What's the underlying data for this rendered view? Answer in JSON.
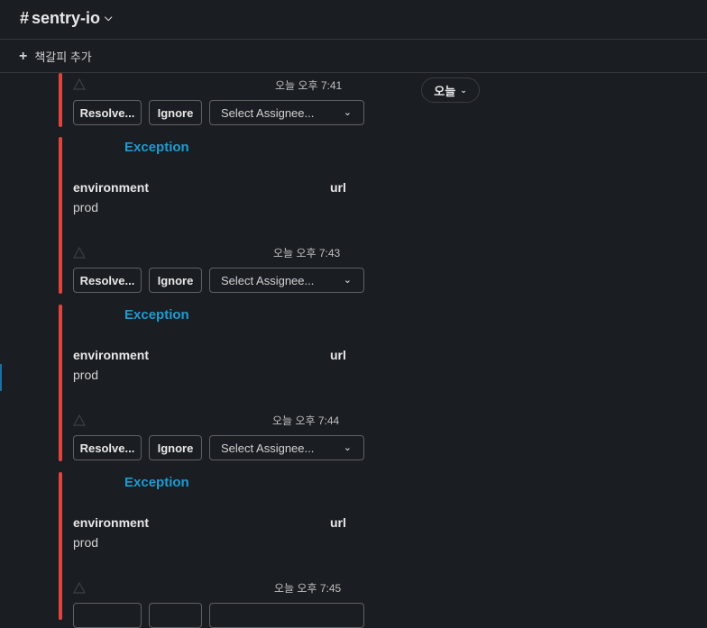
{
  "header": {
    "channel_name": "sentry-io"
  },
  "bookmarks": {
    "add_label": "책갈피 추가"
  },
  "date_pill": {
    "label": "오늘"
  },
  "messages": [
    {
      "exception": "",
      "timestamp": "오늘 오후 7:41",
      "actions": {
        "resolve": "Resolve...",
        "ignore": "Ignore",
        "assignee_placeholder": "Select Assignee..."
      }
    },
    {
      "exception": "Exception",
      "fields": [
        {
          "label": "environment",
          "value": "prod"
        },
        {
          "label": "url",
          "value": ""
        }
      ],
      "timestamp": "오늘 오후 7:43",
      "actions": {
        "resolve": "Resolve...",
        "ignore": "Ignore",
        "assignee_placeholder": "Select Assignee..."
      }
    },
    {
      "exception": "Exception",
      "fields": [
        {
          "label": "environment",
          "value": "prod"
        },
        {
          "label": "url",
          "value": ""
        }
      ],
      "timestamp": "오늘 오후 7:44",
      "actions": {
        "resolve": "Resolve...",
        "ignore": "Ignore",
        "assignee_placeholder": "Select Assignee..."
      }
    },
    {
      "exception": "Exception",
      "fields": [
        {
          "label": "environment",
          "value": "prod"
        },
        {
          "label": "url",
          "value": ""
        }
      ],
      "timestamp": "오늘 오후 7:45",
      "actions": {
        "resolve": "",
        "ignore": "",
        "assignee_placeholder": ""
      }
    }
  ],
  "colors": {
    "background": "#1a1d21",
    "accent_bar": "#e0453d",
    "link": "#1d9bd1"
  },
  "icons": {
    "warning": "warning-icon",
    "chevron": "chevron-down-icon",
    "plus": "plus-icon"
  }
}
